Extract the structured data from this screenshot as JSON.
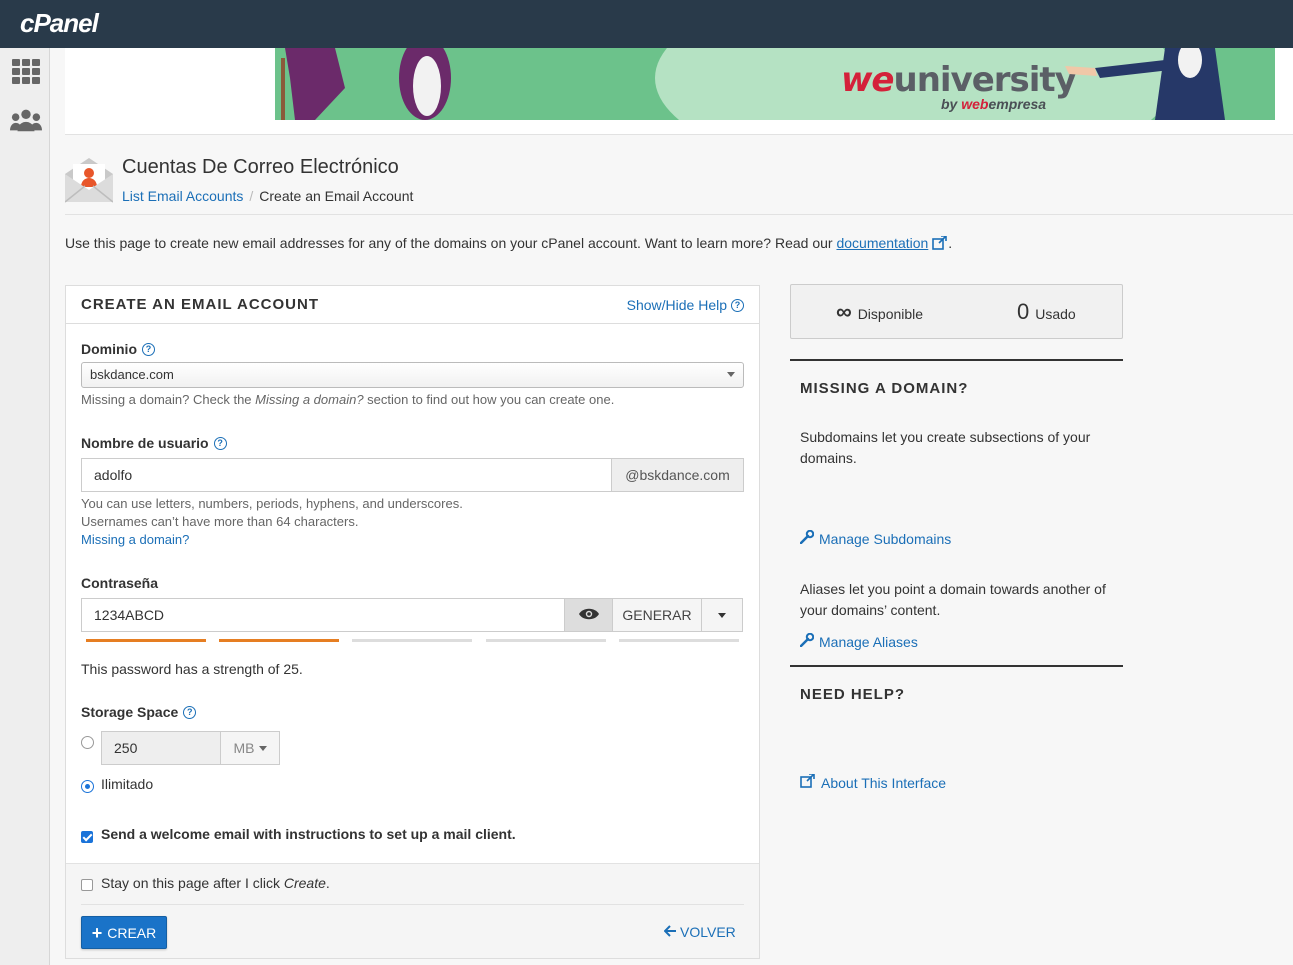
{
  "app": {
    "logo": "cPanel"
  },
  "banner": {
    "brand_we": "we",
    "brand_rest": "university",
    "by_prefix": "by ",
    "by_web": "web",
    "by_rest": "empresa"
  },
  "header": {
    "title": "Cuentas De Correo Electrónico",
    "breadcrumb_link": "List Email Accounts",
    "breadcrumb_sep": "/",
    "breadcrumb_current": "Create an Email Account"
  },
  "intro": {
    "text": "Use this page to create new email addresses for any of the domains on your cPanel account. Want to learn more? Read our ",
    "link": "documentation",
    "end": "."
  },
  "form": {
    "title": "CREATE AN EMAIL ACCOUNT",
    "help_toggle": "Show/Hide Help",
    "domain_label": "Dominio",
    "domain_value": "bskdance.com",
    "domain_hint_1": "Missing a domain? Check the ",
    "domain_hint_em": "Missing a domain?",
    "domain_hint_2": " section to find out how you can create one.",
    "username_label": "Nombre de usuario",
    "username_value": "adolfo",
    "username_suffix": "@bskdance.com",
    "username_hint_1": "You can use letters, numbers, periods, hyphens, and underscores.",
    "username_hint_2": "Usernames can’t have more than 64 characters.",
    "username_missing_link": "Missing a domain?",
    "password_label": "Contraseña",
    "password_value": "1234ABCD",
    "generate_label": "GENERAR",
    "strength_bars_filled": 2,
    "strength_bars_total": 5,
    "strength_text": "This password has a strength of 25.",
    "storage_label": "Storage Space",
    "storage_value": "250",
    "storage_unit": "MB",
    "storage_unlimited": "Ilimitado",
    "welcome_label": "Send a welcome email with instructions to set up a mail client.",
    "stay_label_1": "Stay on this page after I click ",
    "stay_label_em": "Create",
    "stay_label_2": ".",
    "create_button": "CREAR",
    "back_button": "VOLVER"
  },
  "stats": {
    "available_value": "∞",
    "available_label": "Disponible",
    "used_value": "0",
    "used_label": "Usado"
  },
  "missing_domain": {
    "heading": "MISSING A DOMAIN?",
    "subdomains_text": "Subdomains let you create subsections of your domains.",
    "subdomains_link": "Manage Subdomains",
    "aliases_text": "Aliases let you point a domain towards another of your domains’ content.",
    "aliases_link": "Manage Aliases"
  },
  "need_help": {
    "heading": "NEED HELP?",
    "about_link": "About This Interface"
  },
  "colors": {
    "topbar": "#293a4a",
    "link": "#1b6fb7",
    "primary": "#1a73c8",
    "strength": "#e67e22"
  }
}
